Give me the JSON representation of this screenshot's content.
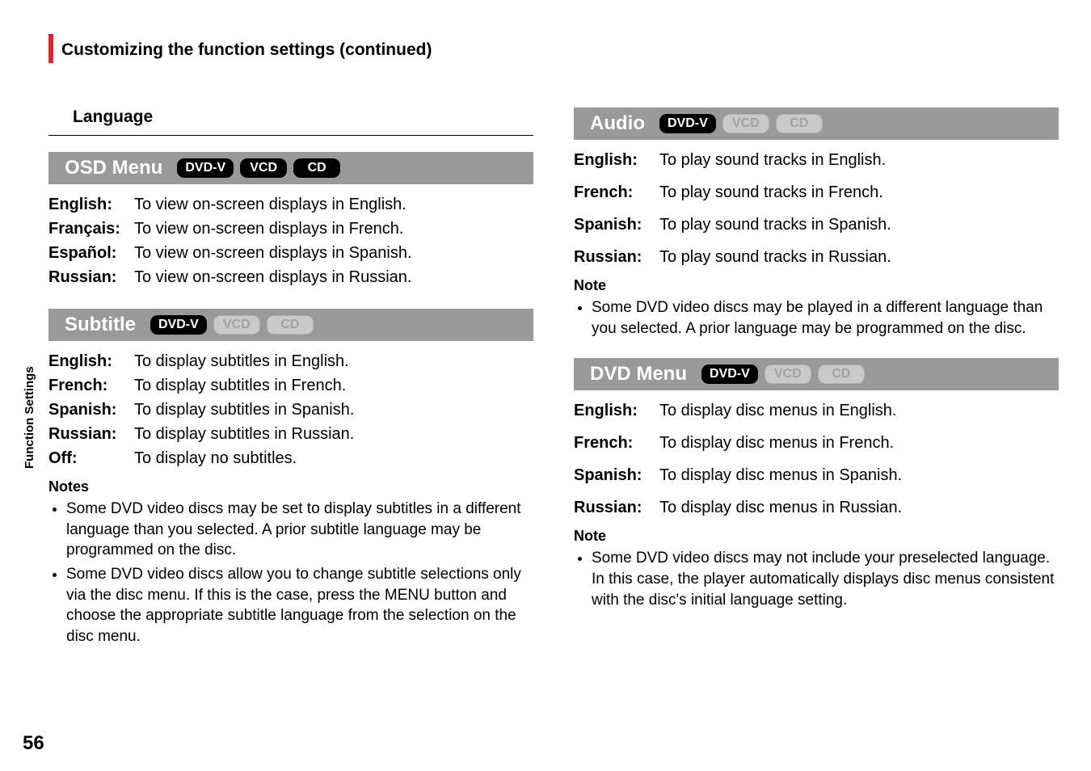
{
  "header": {
    "title": "Customizing the function settings (continued)"
  },
  "sidebar": {
    "section": "Function Settings",
    "page_number": "56"
  },
  "left": {
    "language_heading": "Language",
    "osd": {
      "title": "OSD Menu",
      "badges": {
        "dvdv": "DVD-V",
        "vcd": "VCD",
        "cd": "CD"
      },
      "rows": [
        {
          "term": "English:",
          "desc": "To view on-screen displays in English."
        },
        {
          "term": "Français:",
          "desc": "To view on-screen displays in French."
        },
        {
          "term": "Español:",
          "desc": "To view on-screen displays in Spanish."
        },
        {
          "term": "Russian:",
          "desc": "To view on-screen displays in Russian."
        }
      ]
    },
    "subtitle": {
      "title": "Subtitle",
      "badges": {
        "dvdv": "DVD-V",
        "vcd": "VCD",
        "cd": "CD"
      },
      "rows": [
        {
          "term": "English:",
          "desc": "To display subtitles in English."
        },
        {
          "term": "French:",
          "desc": "To display subtitles in French."
        },
        {
          "term": "Spanish:",
          "desc": "To display subtitles in Spanish."
        },
        {
          "term": "Russian:",
          "desc": "To display subtitles in Russian."
        },
        {
          "term": "Off:",
          "desc": "To display no subtitles."
        }
      ],
      "notes_head": "Notes",
      "notes": [
        "Some DVD video discs may be set to display subtitles in a different language than you selected. A prior subtitle language may be programmed on the disc.",
        "Some DVD video discs allow you to change subtitle selections only via the disc menu. If this is the case, press the MENU button and choose the appropriate subtitle language from the selection on the disc menu."
      ]
    }
  },
  "right": {
    "audio": {
      "title": "Audio",
      "badges": {
        "dvdv": "DVD-V",
        "vcd": "VCD",
        "cd": "CD"
      },
      "rows": [
        {
          "term": "English:",
          "desc": "To play sound tracks in English."
        },
        {
          "term": "French:",
          "desc": "To play sound tracks in French."
        },
        {
          "term": "Spanish:",
          "desc": "To play sound tracks in Spanish."
        },
        {
          "term": "Russian:",
          "desc": "To play sound tracks in Russian."
        }
      ],
      "notes_head": "Note",
      "notes": [
        "Some DVD video discs may be played in a different language than you selected. A prior language may be programmed on the disc."
      ]
    },
    "dvdmenu": {
      "title": "DVD Menu",
      "badges": {
        "dvdv": "DVD-V",
        "vcd": "VCD",
        "cd": "CD"
      },
      "rows": [
        {
          "term": "English:",
          "desc": "To display disc menus in English."
        },
        {
          "term": "French:",
          "desc": "To display disc menus in French."
        },
        {
          "term": "Spanish:",
          "desc": "To display disc menus in Spanish."
        },
        {
          "term": "Russian:",
          "desc": "To display disc menus in Russian."
        }
      ],
      "notes_head": "Note",
      "notes": [
        "Some DVD video discs may not include your preselected language. In this case, the player automatically displays disc menus consistent with the disc's initial language setting."
      ]
    }
  }
}
